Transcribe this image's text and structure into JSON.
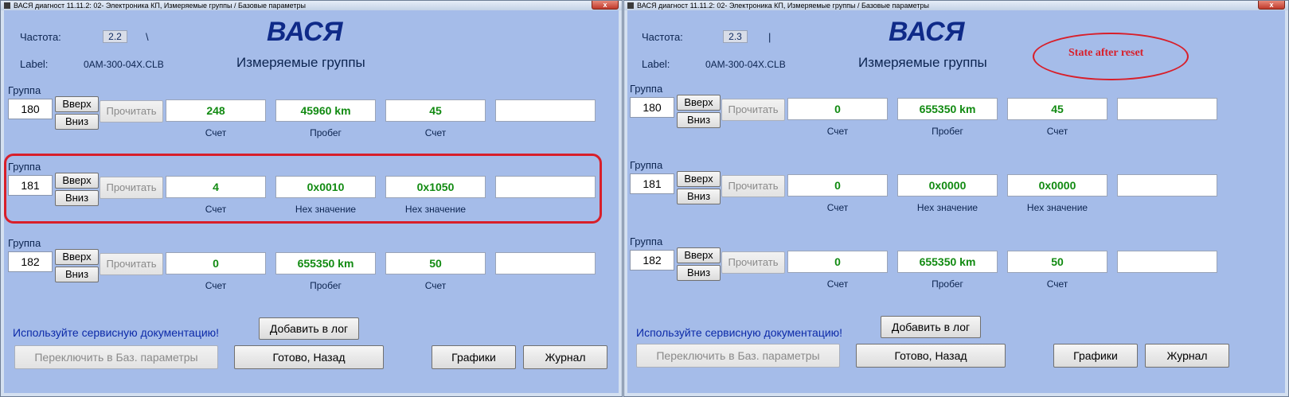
{
  "left": {
    "window_title": "ВАСЯ диагност 11.11.2: 02- Электроника КП,  Измеряемые группы / Базовые параметры",
    "close": "x",
    "freq_label": "Частота:",
    "freq_value": "2.2",
    "freq_indicator": "\\",
    "label_label": "Label:",
    "label_value": "0AM-300-04X.CLB",
    "app_title": "ВАСЯ",
    "subtitle": "Измеряемые группы",
    "groups": [
      {
        "label": "Группа",
        "number": "180",
        "up": "Вверх",
        "down": "Вниз",
        "read": "Прочитать",
        "fields": [
          "248",
          "45960 km",
          "45",
          ""
        ],
        "units": [
          "Счет",
          "Пробег",
          "Счет",
          ""
        ]
      },
      {
        "label": "Группа",
        "number": "181",
        "up": "Вверх",
        "down": "Вниз",
        "read": "Прочитать",
        "fields": [
          "4",
          "0x0010",
          "0x1050",
          ""
        ],
        "units": [
          "Счет",
          "Hex значение",
          "Hex значение",
          ""
        ]
      },
      {
        "label": "Группа",
        "number": "182",
        "up": "Вверх",
        "down": "Вниз",
        "read": "Прочитать",
        "fields": [
          "0",
          "655350 km",
          "50",
          ""
        ],
        "units": [
          "Счет",
          "Пробег",
          "Счет",
          ""
        ]
      }
    ],
    "note": "Используйте сервисную документацию!",
    "add_log": "Добавить в лог",
    "switch_basic": "Переключить в Баз. параметры",
    "done_back": "Готово, Назад",
    "graphs": "Графики",
    "journal": "Журнал"
  },
  "right": {
    "window_title": "ВАСЯ диагност 11.11.2: 02- Электроника КП,  Измеряемые группы / Базовые параметры",
    "close": "x",
    "freq_label": "Частота:",
    "freq_value": "2.3",
    "freq_indicator": "|",
    "label_label": "Label:",
    "label_value": "0AM-300-04X.CLB",
    "app_title": "ВАСЯ",
    "subtitle": "Измеряемые группы",
    "annotation": "State after reset",
    "groups": [
      {
        "label": "Группа",
        "number": "180",
        "up": "Вверх",
        "down": "Вниз",
        "read": "Прочитать",
        "fields": [
          "0",
          "655350 km",
          "45",
          ""
        ],
        "units": [
          "Счет",
          "Пробег",
          "Счет",
          ""
        ]
      },
      {
        "label": "Группа",
        "number": "181",
        "up": "Вверх",
        "down": "Вниз",
        "read": "Прочитать",
        "fields": [
          "0",
          "0x0000",
          "0x0000",
          ""
        ],
        "units": [
          "Счет",
          "Hex значение",
          "Hex значение",
          ""
        ]
      },
      {
        "label": "Группа",
        "number": "182",
        "up": "Вверх",
        "down": "Вниз",
        "read": "Прочитать",
        "fields": [
          "0",
          "655350 km",
          "50",
          ""
        ],
        "units": [
          "Счет",
          "Пробег",
          "Счет",
          ""
        ]
      }
    ],
    "note": "Используйте сервисную документацию!",
    "add_log": "Добавить в лог",
    "switch_basic": "Переключить в Баз. параметры",
    "done_back": "Готово, Назад",
    "graphs": "Графики",
    "journal": "Журнал"
  },
  "colors": {
    "client_bg": "#a5bce9",
    "value_green": "#118a11",
    "title_blue": "#0f2a88",
    "annotation_red": "#d81f2a"
  }
}
